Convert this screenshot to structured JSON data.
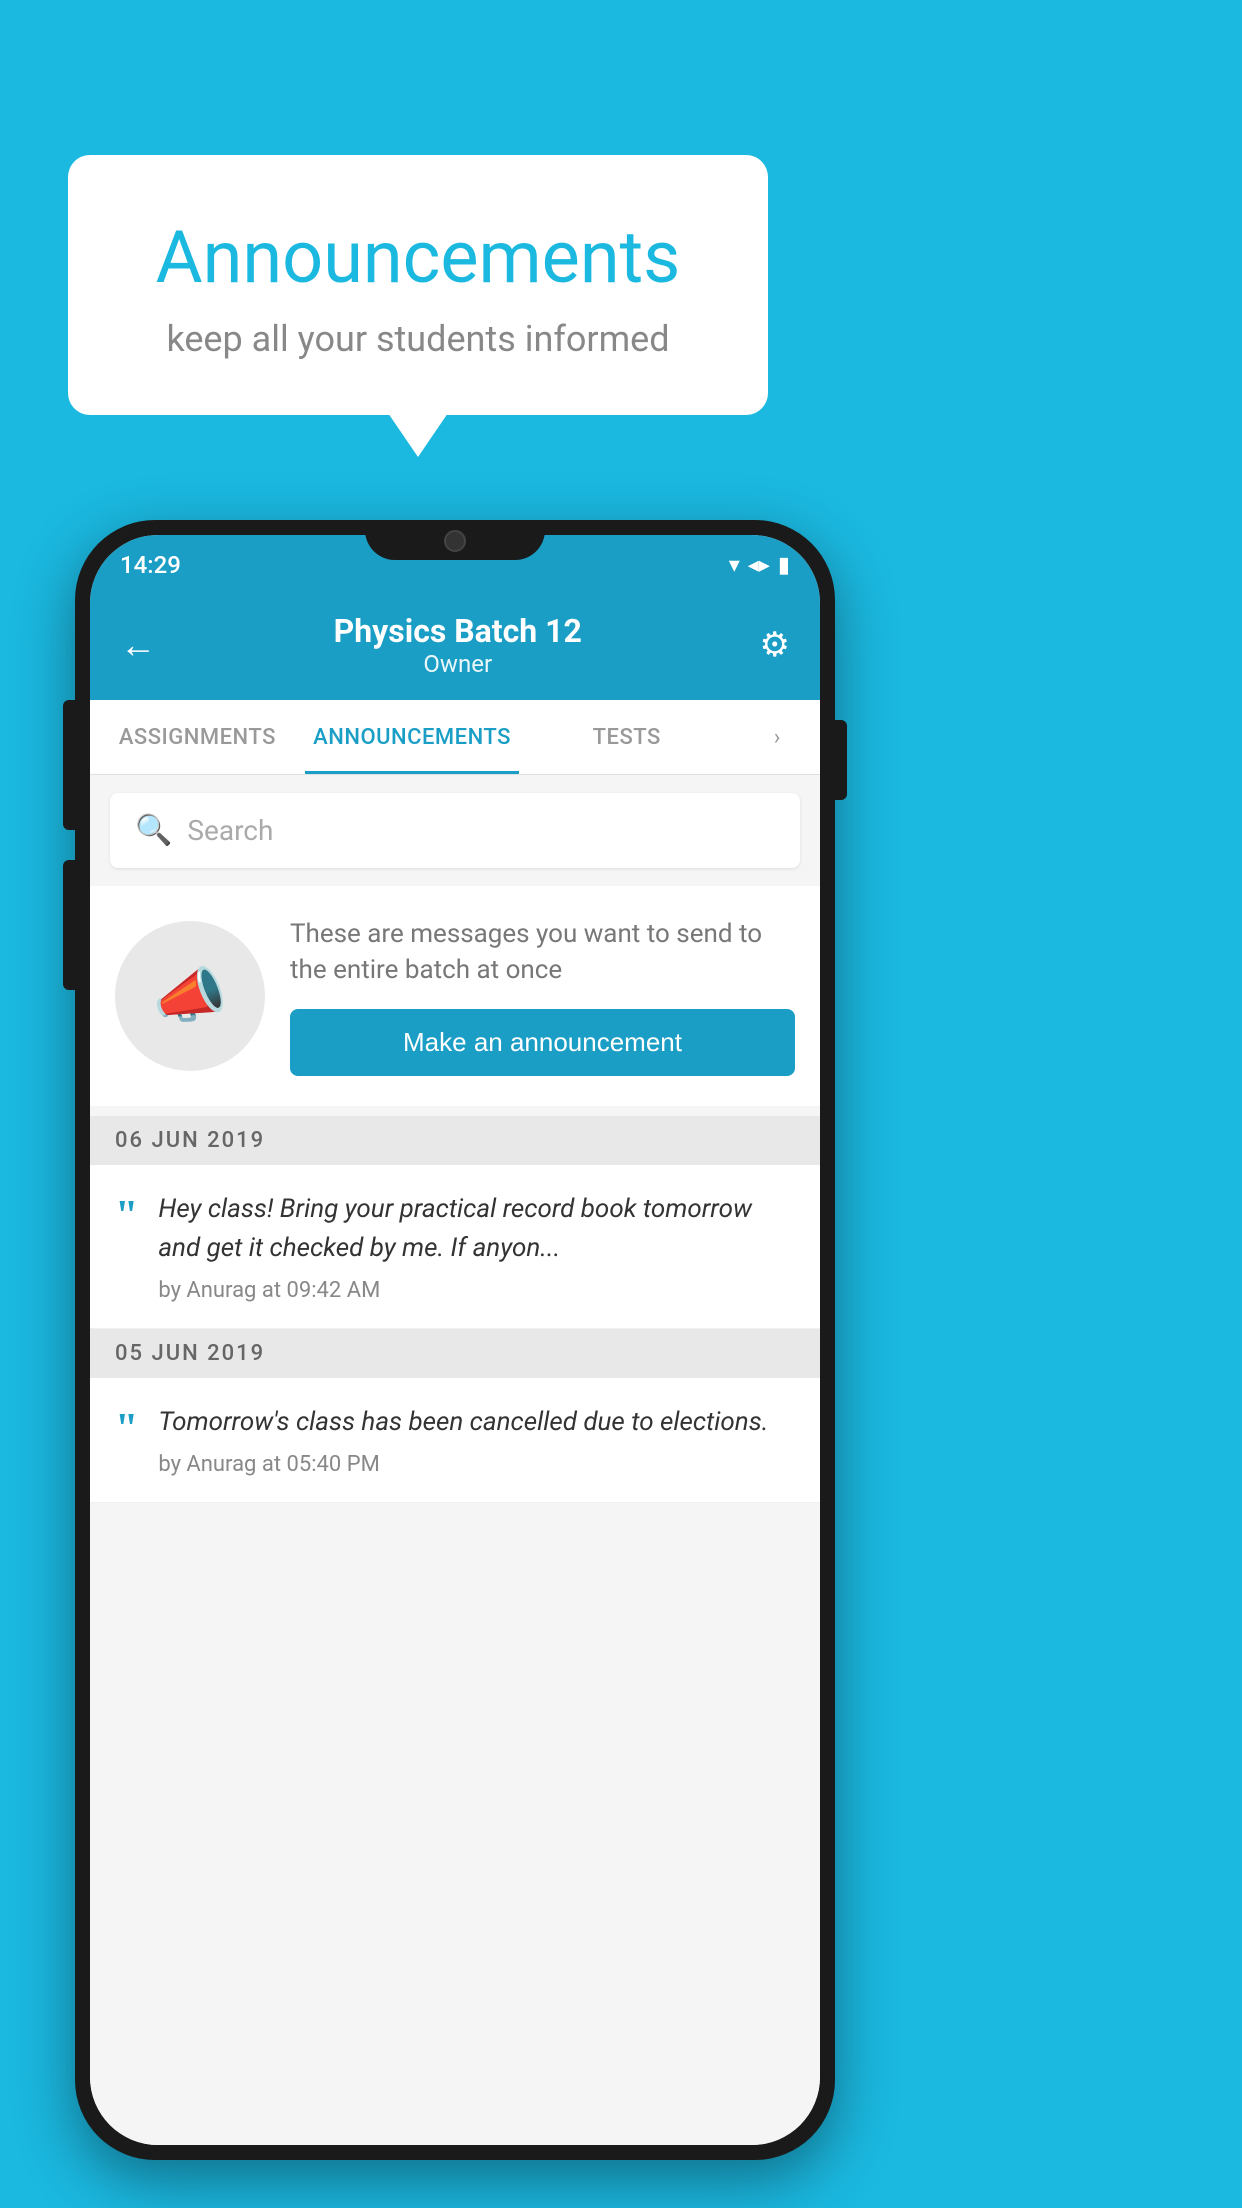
{
  "background_color": "#1bb8e0",
  "bubble": {
    "title": "Announcements",
    "subtitle": "keep all your students informed"
  },
  "phone": {
    "status_bar": {
      "time": "14:29",
      "wifi": "▼",
      "signal": "▲",
      "battery": "▮"
    },
    "header": {
      "title": "Physics Batch 12",
      "subtitle": "Owner",
      "back_label": "←",
      "settings_label": "⚙"
    },
    "tabs": [
      {
        "label": "ASSIGNMENTS",
        "active": false
      },
      {
        "label": "ANNOUNCEMENTS",
        "active": true
      },
      {
        "label": "TESTS",
        "active": false
      }
    ],
    "search": {
      "placeholder": "Search"
    },
    "promo": {
      "description": "These are messages you want to send to the entire batch at once",
      "button_label": "Make an announcement"
    },
    "date_groups": [
      {
        "date": "06  JUN  2019",
        "items": [
          {
            "text": "Hey class! Bring your practical record book tomorrow and get it checked by me. If anyon...",
            "meta": "by Anurag at 09:42 AM"
          }
        ]
      },
      {
        "date": "05  JUN  2019",
        "items": [
          {
            "text": "Tomorrow's class has been cancelled due to elections.",
            "meta": "by Anurag at 05:40 PM"
          }
        ]
      }
    ]
  }
}
